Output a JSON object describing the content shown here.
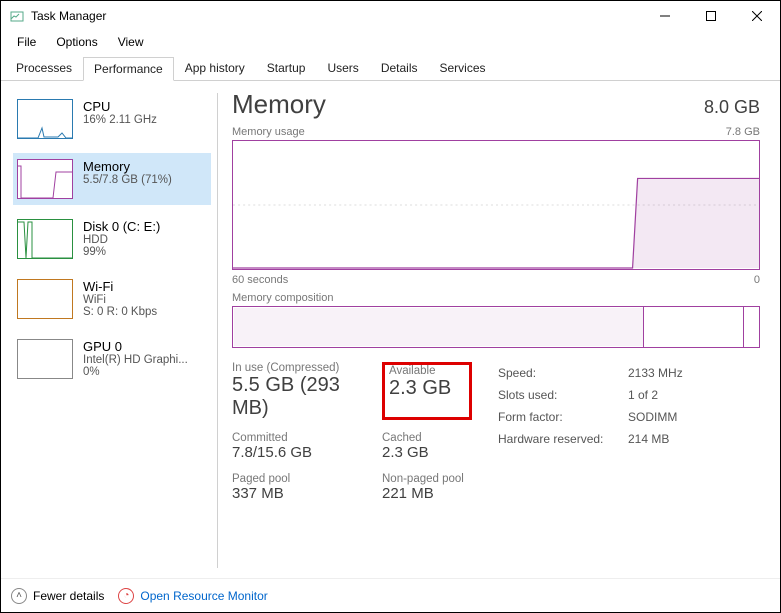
{
  "window": {
    "title": "Task Manager",
    "menus": {
      "file": "File",
      "options": "Options",
      "view": "View"
    }
  },
  "tabs": {
    "processes": "Processes",
    "performance": "Performance",
    "apphistory": "App history",
    "startup": "Startup",
    "users": "Users",
    "details": "Details",
    "services": "Services"
  },
  "side": {
    "cpu": {
      "title": "CPU",
      "sub": "16% 2.11 GHz"
    },
    "memory": {
      "title": "Memory",
      "sub": "5.5/7.8 GB (71%)"
    },
    "disk": {
      "title": "Disk 0 (C: E:)",
      "sub": "HDD",
      "sub2": "99%"
    },
    "wifi": {
      "title": "Wi-Fi",
      "sub": "WiFi",
      "sub2": "S: 0 R: 0 Kbps"
    },
    "gpu": {
      "title": "GPU 0",
      "sub": "Intel(R) HD Graphi...",
      "sub2": "0%"
    }
  },
  "main": {
    "title": "Memory",
    "capacity": "8.0 GB",
    "chart_label": "Memory usage",
    "chart_max": "7.8 GB",
    "axis_left": "60 seconds",
    "axis_right": "0",
    "comp_label": "Memory composition"
  },
  "stats": {
    "inuse_label": "In use (Compressed)",
    "inuse_value": "5.5 GB (293 MB)",
    "available_label": "Available",
    "available_value": "2.3 GB",
    "committed_label": "Committed",
    "committed_value": "7.8/15.6 GB",
    "cached_label": "Cached",
    "cached_value": "2.3 GB",
    "paged_label": "Paged pool",
    "paged_value": "337 MB",
    "nonpaged_label": "Non-paged pool",
    "nonpaged_value": "221 MB"
  },
  "specs": {
    "speed_label": "Speed:",
    "speed_value": "2133 MHz",
    "slots_label": "Slots used:",
    "slots_value": "1 of 2",
    "form_label": "Form factor:",
    "form_value": "SODIMM",
    "reserved_label": "Hardware reserved:",
    "reserved_value": "214 MB"
  },
  "footer": {
    "fewer": "Fewer details",
    "orm": "Open Resource Monitor"
  },
  "chart_data": {
    "type": "line",
    "title": "Memory usage",
    "xlabel": "seconds ago",
    "ylabel": "GB",
    "xlim": [
      60,
      0
    ],
    "ylim": [
      0,
      7.8
    ],
    "x": [
      60,
      18,
      17,
      0
    ],
    "y": [
      0.0,
      0.0,
      5.5,
      5.5
    ]
  }
}
